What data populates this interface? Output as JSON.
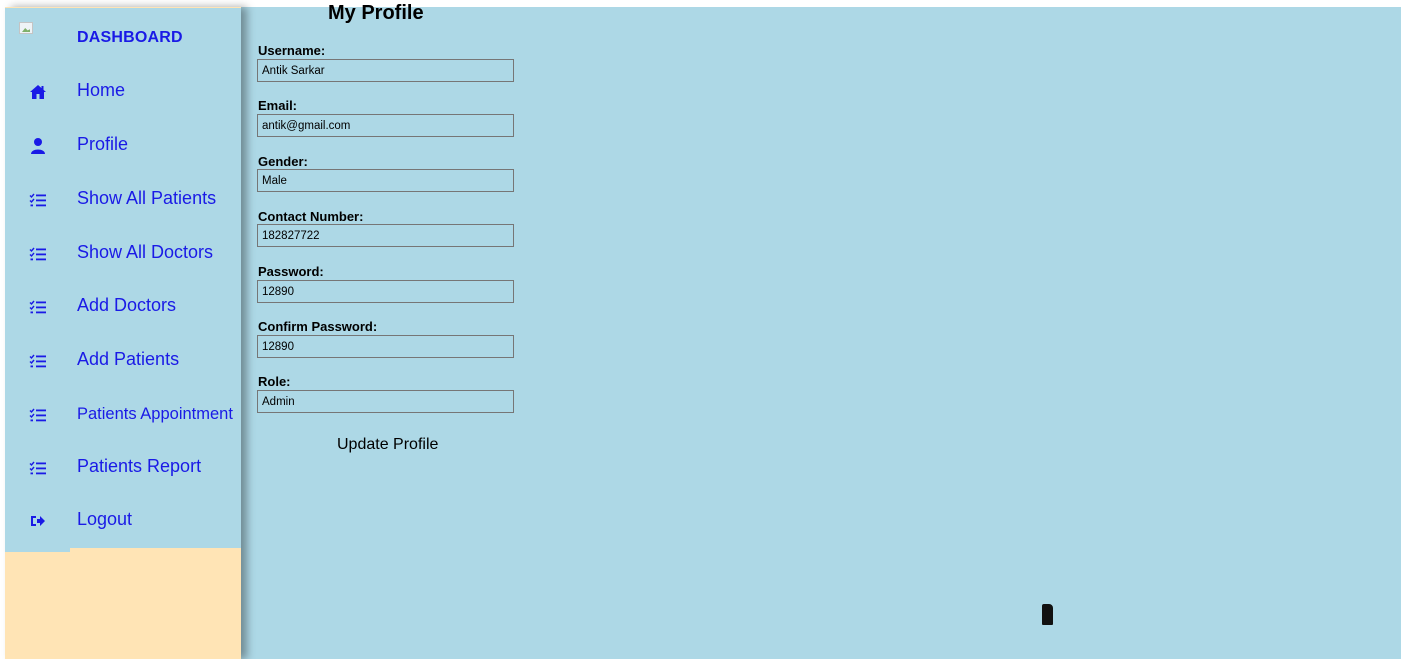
{
  "sidebar": {
    "brand": "DASHBOARD",
    "items": [
      {
        "label": "Home",
        "icon": "home-icon"
      },
      {
        "label": "Profile",
        "icon": "user-icon"
      },
      {
        "label": "Show All Patients",
        "icon": "list-check-icon"
      },
      {
        "label": "Show All Doctors",
        "icon": "list-check-icon"
      },
      {
        "label": "Add Doctors",
        "icon": "list-check-icon"
      },
      {
        "label": "Add Patients",
        "icon": "list-check-icon"
      },
      {
        "label": "Patients Appointment",
        "icon": "list-check-icon"
      },
      {
        "label": "Patients Report",
        "icon": "list-check-icon"
      },
      {
        "label": "Logout",
        "icon": "sign-out-icon"
      }
    ]
  },
  "main": {
    "title": "My Profile",
    "fields": [
      {
        "label": "Username:",
        "value": "Antik Sarkar"
      },
      {
        "label": "Email:",
        "value": "antik@gmail.com"
      },
      {
        "label": "Gender:",
        "value": "Male"
      },
      {
        "label": "Contact Number:",
        "value": "182827722"
      },
      {
        "label": "Password:",
        "value": "12890"
      },
      {
        "label": "Confirm Password:",
        "value": "12890"
      },
      {
        "label": "Role:",
        "value": "Admin"
      }
    ],
    "update_label": "Update Profile"
  },
  "colors": {
    "background": "#add8e6",
    "sidebar_bg": "#ffe4b5",
    "link": "#1a1ae6"
  }
}
